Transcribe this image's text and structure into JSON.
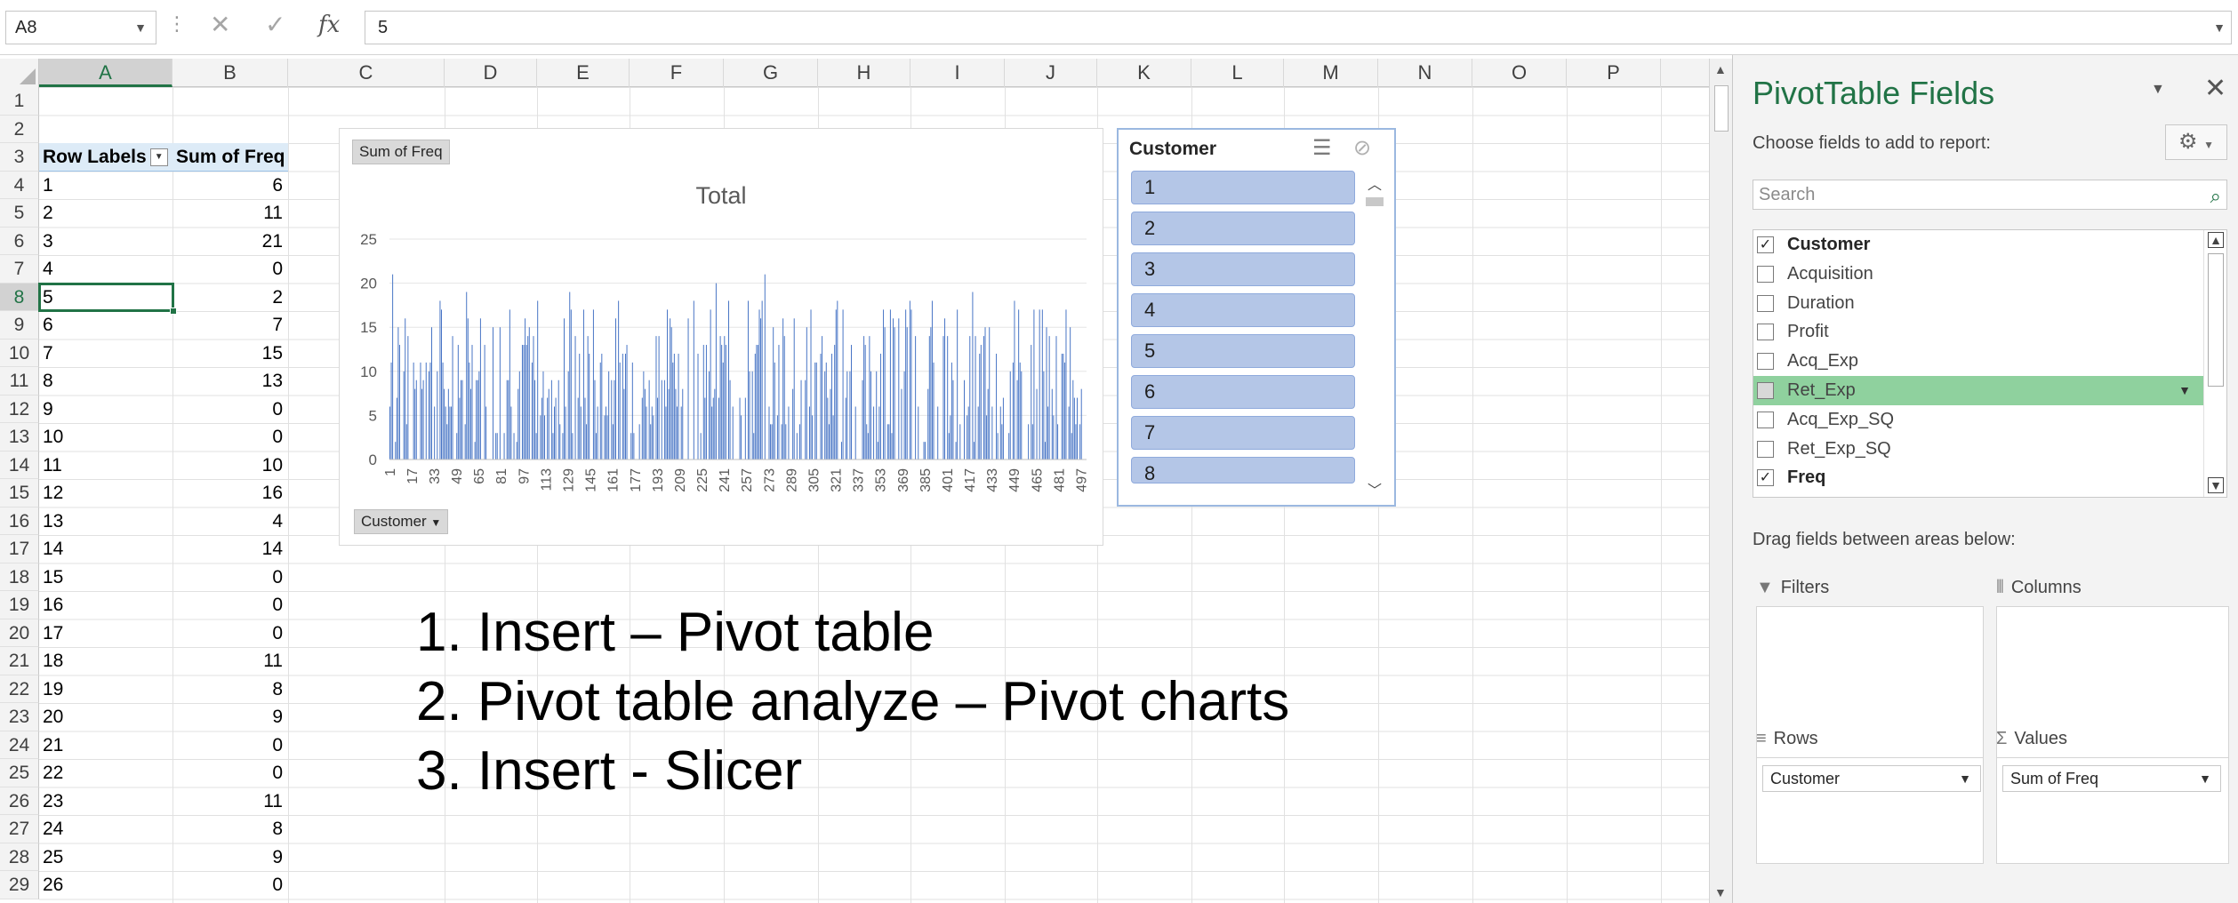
{
  "formula_bar": {
    "name_box": "A8",
    "formula_value": "5",
    "fx_label": "fx"
  },
  "columns": [
    "A",
    "B",
    "C",
    "D",
    "E",
    "F",
    "G",
    "H",
    "I",
    "J",
    "K",
    "L",
    "M",
    "N",
    "O",
    "P"
  ],
  "rows": [
    "1",
    "2",
    "3",
    "4",
    "5",
    "6",
    "7",
    "8",
    "9",
    "10",
    "11",
    "12",
    "13",
    "14",
    "15",
    "16",
    "17",
    "18",
    "19",
    "20",
    "21",
    "22",
    "23",
    "24",
    "25",
    "26",
    "27",
    "28",
    "29"
  ],
  "pivot_table": {
    "header_row_labels": "Row Labels",
    "header_sum": "Sum of Freq",
    "data": [
      [
        "1",
        "6"
      ],
      [
        "2",
        "11"
      ],
      [
        "3",
        "21"
      ],
      [
        "4",
        "0"
      ],
      [
        "5",
        "2"
      ],
      [
        "6",
        "7"
      ],
      [
        "7",
        "15"
      ],
      [
        "8",
        "13"
      ],
      [
        "9",
        "0"
      ],
      [
        "10",
        "0"
      ],
      [
        "11",
        "10"
      ],
      [
        "12",
        "16"
      ],
      [
        "13",
        "4"
      ],
      [
        "14",
        "14"
      ],
      [
        "15",
        "0"
      ],
      [
        "16",
        "0"
      ],
      [
        "17",
        "0"
      ],
      [
        "18",
        "11"
      ],
      [
        "19",
        "8"
      ],
      [
        "20",
        "9"
      ],
      [
        "21",
        "0"
      ],
      [
        "22",
        "0"
      ],
      [
        "23",
        "11"
      ],
      [
        "24",
        "8"
      ],
      [
        "25",
        "9"
      ],
      [
        "26",
        "0"
      ]
    ]
  },
  "chart": {
    "value_field_button": "Sum of Freq",
    "axis_field_button": "Customer"
  },
  "chart_data": {
    "type": "bar",
    "title": "Total",
    "ylim": [
      0,
      25
    ],
    "yticks": [
      "0",
      "5",
      "10",
      "15",
      "20",
      "25"
    ],
    "xtick_labels": [
      "1",
      "17",
      "33",
      "49",
      "65",
      "81",
      "97",
      "113",
      "129",
      "145",
      "161",
      "177",
      "193",
      "209",
      "225",
      "241",
      "257",
      "273",
      "289",
      "305",
      "321",
      "337",
      "353",
      "369",
      "385",
      "401",
      "417",
      "433",
      "449",
      "465",
      "481",
      "497"
    ],
    "categories_count": 500,
    "values_first_26": [
      6,
      11,
      21,
      0,
      2,
      7,
      15,
      13,
      0,
      0,
      10,
      16,
      4,
      14,
      0,
      0,
      0,
      11,
      8,
      9,
      0,
      0,
      11,
      8,
      9,
      0
    ],
    "grid": "horizontal",
    "color": "#4472c4"
  },
  "slicer": {
    "title": "Customer",
    "items": [
      "1",
      "2",
      "3",
      "4",
      "5",
      "6",
      "7",
      "8"
    ]
  },
  "instructions": [
    "1. Insert – Pivot table",
    "2. Pivot table analyze – Pivot charts",
    "3. Insert - Slicer"
  ],
  "pane": {
    "title": "PivotTable Fields",
    "subtitle": "Choose fields to add to report:",
    "search_placeholder": "Search",
    "fields": [
      {
        "name": "Customer",
        "checked": true
      },
      {
        "name": "Acquisition",
        "checked": false
      },
      {
        "name": "Duration",
        "checked": false
      },
      {
        "name": "Profit",
        "checked": false
      },
      {
        "name": "Acq_Exp",
        "checked": false
      },
      {
        "name": "Ret_Exp",
        "checked": false
      },
      {
        "name": "Acq_Exp_SQ",
        "checked": false
      },
      {
        "name": "Ret_Exp_SQ",
        "checked": false
      },
      {
        "name": "Freq",
        "checked": true
      }
    ],
    "drag_label": "Drag fields between areas below:",
    "areas": {
      "filters": "Filters",
      "columns": "Columns",
      "rows": "Rows",
      "values": "Values",
      "rows_item": "Customer",
      "values_item": "Sum of Freq"
    }
  },
  "colors": {
    "excel_green": "#217346",
    "bar_blue": "#4472c4",
    "slicer_item": "#b4c6e7",
    "header_fill": "#ddebf7",
    "field_highlight": "#8fd19e"
  }
}
